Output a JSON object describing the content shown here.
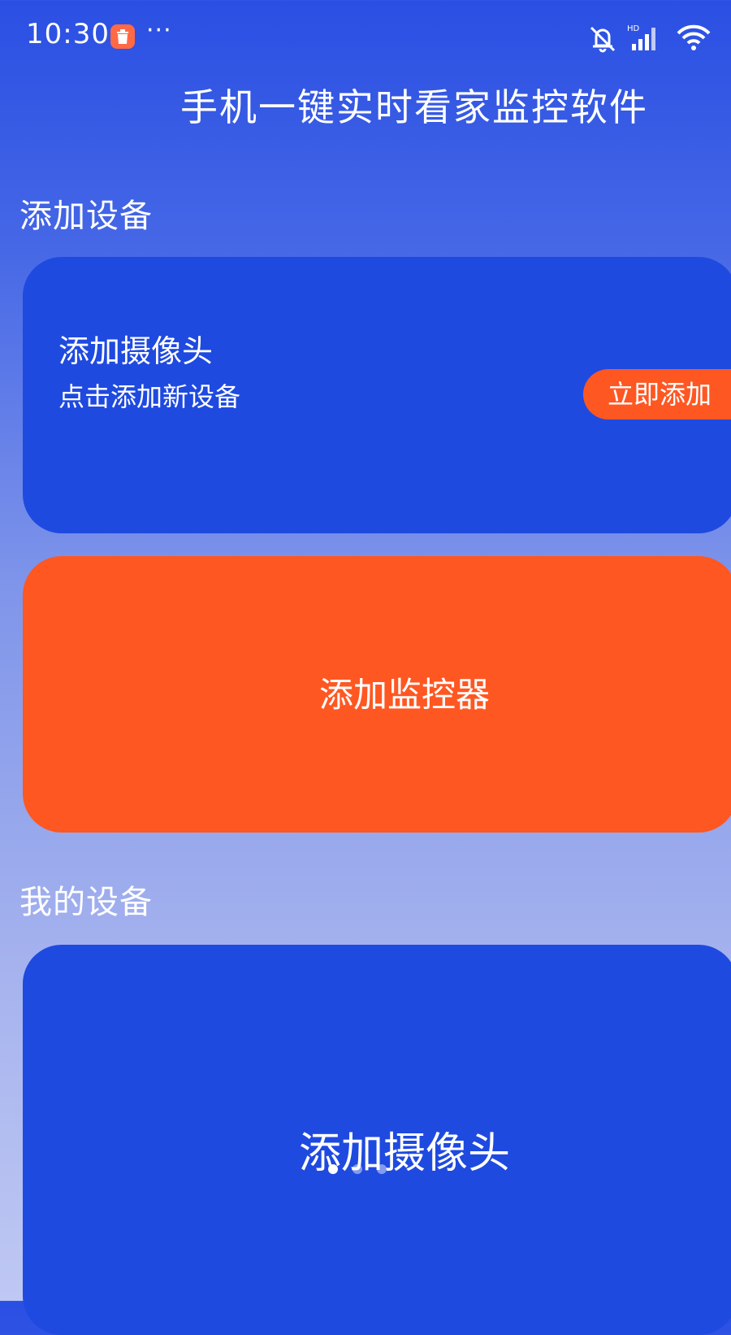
{
  "status_bar": {
    "time": "10:30",
    "more_indicator": "···",
    "icons": [
      "app-notification-icon",
      "silent-bell-icon",
      "hd-signal-icon",
      "wifi-icon"
    ],
    "hd_label": "HD"
  },
  "header": {
    "title": "手机一键实时看家监控软件"
  },
  "add_device_section": {
    "label": "添加设备",
    "camera_card": {
      "title": "添加摄像头",
      "subtitle": "点击添加新设备",
      "button_label": "立即添加"
    },
    "monitor_card": {
      "label": "添加监控器"
    }
  },
  "my_devices_section": {
    "label": "我的设备",
    "banner": {
      "label": "添加摄像头",
      "pager_total": 3,
      "pager_active": 1
    }
  },
  "colors": {
    "primary_blue": "#1f4ae0",
    "accent_orange": "#ff5722"
  }
}
